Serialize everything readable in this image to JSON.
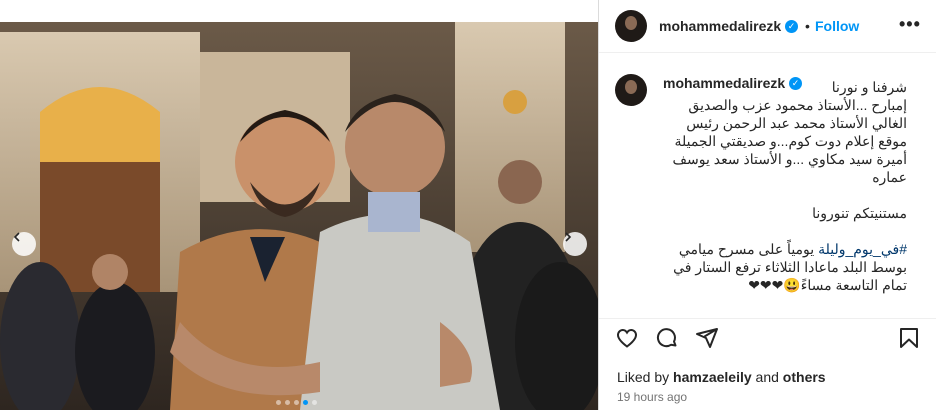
{
  "post": {
    "username": "mohammedalirezk",
    "follow_label": "Follow",
    "separator": "•",
    "more_label": "•••",
    "verified_mark": "✓",
    "caption": {
      "line1": "شرفنا و نورنا",
      "line2": "إمبارح ...الأستاذ محمود عزب والصديق",
      "line3": "الغالي الأستاذ محمد عبد الرحمن رئيس",
      "line4": "موقع إعلام دوت كوم...و صديقتي الجميلة",
      "line5": "أميرة سيد مكاوي ...و الأستاذ سعد يوسف",
      "line6": "عماره",
      "line7": "مستنيتكم تنورونا",
      "hashtag": "#في_يوم_وليلة",
      "line8_rest": " يومياً على مسرح ميامي",
      "line9": "بوسط البلد ماعادا الثلاثاء ترفع الستار في",
      "line10": "تمام التاسعة مساءً😃❤❤❤"
    },
    "likes": {
      "prefix": "Liked by",
      "user": "hamzaeleily",
      "and": "and",
      "others": "others"
    },
    "time_ago": "19 hours ago",
    "carousel": {
      "slide_count": 5,
      "active_slide": 4
    }
  },
  "icons": {
    "like": "heart-icon",
    "comment": "comment-icon",
    "share": "share-icon",
    "save": "bookmark-icon",
    "prev": "chevron-left-icon",
    "next": "chevron-right-icon"
  },
  "colors": {
    "accent": "#0095f6",
    "text": "#262626",
    "muted": "#737373"
  }
}
